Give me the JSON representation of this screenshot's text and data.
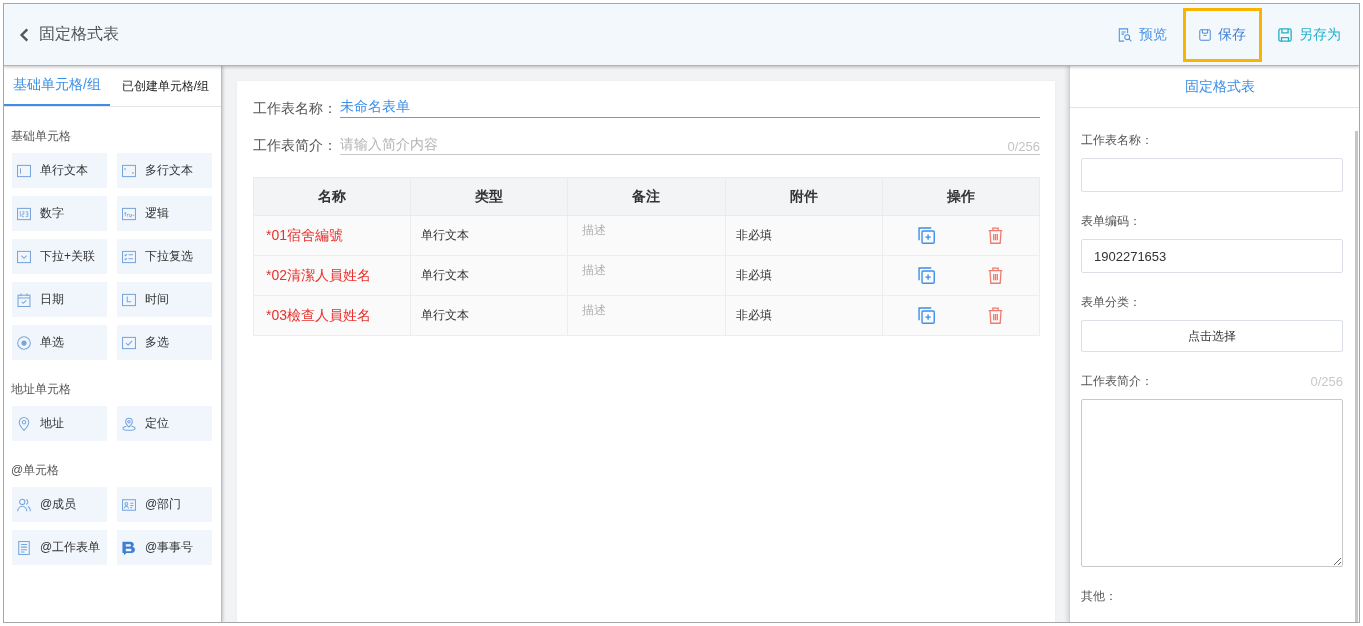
{
  "header": {
    "title": "固定格式表",
    "actions": [
      {
        "kind": "preview",
        "label": "预览",
        "focused": false
      },
      {
        "kind": "save",
        "label": "保存",
        "focused": true
      },
      {
        "kind": "save_as",
        "label": "另存为",
        "focused": false
      }
    ]
  },
  "sidebar": {
    "tabs": [
      {
        "label": "基础单元格/组",
        "selected": true
      },
      {
        "label": "已创建单元格/组",
        "selected": false
      }
    ],
    "sections": [
      {
        "title": "基础单元格",
        "items": [
          {
            "kind": "single_line",
            "label": "单行文本"
          },
          {
            "kind": "multi_line",
            "label": "多行文本"
          },
          {
            "kind": "number",
            "label": "数字"
          },
          {
            "kind": "logic",
            "label": "逻辑"
          },
          {
            "kind": "dropdown",
            "label": "下拉+关联"
          },
          {
            "kind": "dropdown_multi",
            "label": "下拉复选"
          },
          {
            "kind": "date",
            "label": "日期"
          },
          {
            "kind": "time",
            "label": "时间"
          },
          {
            "kind": "radio",
            "label": "单选"
          },
          {
            "kind": "checkbox",
            "label": "多选"
          }
        ]
      },
      {
        "title": "地址单元格",
        "items": [
          {
            "kind": "address",
            "label": "地址"
          },
          {
            "kind": "location",
            "label": "定位"
          }
        ]
      },
      {
        "title": "@单元格",
        "items": [
          {
            "kind": "member",
            "label": "@成员"
          },
          {
            "kind": "department",
            "label": "@部门"
          },
          {
            "kind": "worksheet",
            "label": "@工作表单"
          },
          {
            "kind": "event_number",
            "label": "@事事号"
          }
        ]
      }
    ]
  },
  "editor": {
    "name_field": {
      "label": "工作表名称：",
      "value": "未命名表单",
      "focused": true
    },
    "intro_field": {
      "label": "工作表简介：",
      "placeholder": "请输入简介内容",
      "counter": "0/256",
      "focused": false
    },
    "table": {
      "columns": [
        "名称",
        "类型",
        "备注",
        "附件",
        "操作"
      ],
      "rows": [
        {
          "name": "*01宿舍編號",
          "type": "单行文本",
          "note": {
            "placeholder": "描述"
          },
          "attachment": "非必填"
        },
        {
          "name": "*02清潔人員姓名",
          "type": "单行文本",
          "note": {
            "placeholder": "描述"
          },
          "attachment": "非必填"
        },
        {
          "name": "*03檢查人員姓名",
          "type": "单行文本",
          "note": {
            "placeholder": "描述"
          },
          "attachment": "非必填"
        }
      ]
    }
  },
  "properties": {
    "title": "固定格式表",
    "fields": [
      {
        "kind": "input",
        "label": "工作表名称："
      },
      {
        "kind": "input",
        "label": "表单编码：",
        "value": "1902271653"
      },
      {
        "kind": "select",
        "label": "表单分类：",
        "button": "点击选择"
      },
      {
        "kind": "textarea",
        "label": "工作表简介：",
        "counter": "0/256"
      },
      {
        "kind": "section",
        "label": "其他："
      }
    ]
  }
}
